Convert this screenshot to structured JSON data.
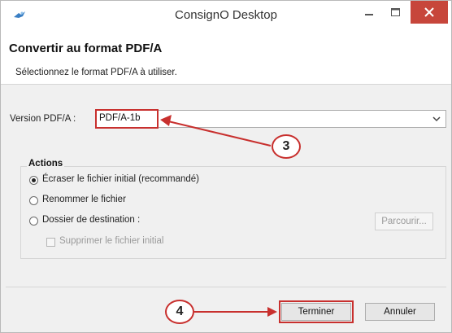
{
  "window": {
    "title": "ConsignO Desktop",
    "app_icon": "consigno-bird-icon"
  },
  "header": {
    "title": "Convertir au format PDF/A",
    "subtitle": "Sélectionnez le format PDF/A à utiliser."
  },
  "version": {
    "label": "Version PDF/A :",
    "selected": "PDF/A-1b"
  },
  "actions": {
    "title": "Actions",
    "option_overwrite": "Écraser le fichier initial (recommandé)",
    "option_rename": "Renommer le fichier",
    "option_destination": "Dossier de destination :",
    "browse_label": "Parcourir...",
    "delete_original": "Supprimer le fichier initial",
    "selected_option": "overwrite"
  },
  "footer": {
    "finish_label": "Terminer",
    "cancel_label": "Annuler"
  },
  "annotations": {
    "step3": "3",
    "step4": "4"
  },
  "colors": {
    "annotation_red": "#c8302e",
    "close_button": "#c7463b"
  }
}
